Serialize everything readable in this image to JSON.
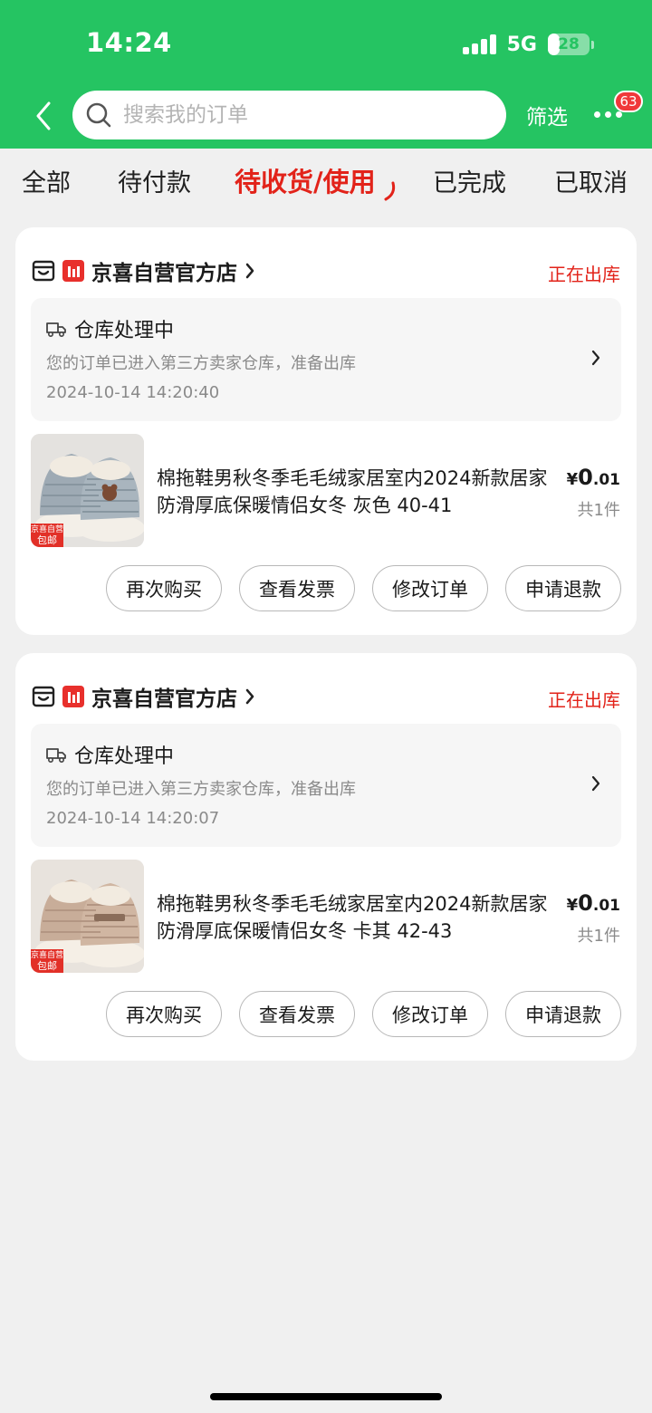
{
  "status_bar": {
    "time": "14:24",
    "network": "5G",
    "battery": "28",
    "battery_level": 0.28
  },
  "header": {
    "search_placeholder": "搜索我的订单",
    "filter_label": "筛选",
    "message_badge": "63"
  },
  "tabs": [
    {
      "label": "全部",
      "active": false
    },
    {
      "label": "待付款",
      "active": false
    },
    {
      "label": "待收货/使用",
      "active": true
    },
    {
      "label": "已完成",
      "active": false
    },
    {
      "label": "已取消",
      "active": false
    }
  ],
  "orders": [
    {
      "store_name": "京喜自营官方店",
      "status": "正在出库",
      "progress_title": "仓库处理中",
      "progress_desc": "您的订单已进入第三方卖家仓库，准备出库",
      "progress_time": "2024-10-14 14:20:40",
      "product_title": "棉拖鞋男秋冬季毛毛绒家居室内2024新款居家防滑厚底保暖情侣女冬 灰色 40-41",
      "image_tag_line1": "京喜自营",
      "image_tag_line2": "包邮",
      "price_currency": "¥",
      "price_int": "0",
      "price_dec": ".01",
      "quantity": "共1件",
      "buttons": [
        "再次购买",
        "查看发票",
        "修改订单",
        "申请退款"
      ]
    },
    {
      "store_name": "京喜自营官方店",
      "status": "正在出库",
      "progress_title": "仓库处理中",
      "progress_desc": "您的订单已进入第三方卖家仓库，准备出库",
      "progress_time": "2024-10-14 14:20:07",
      "product_title": "棉拖鞋男秋冬季毛毛绒家居室内2024新款居家防滑厚底保暖情侣女冬 卡其 42-43",
      "image_tag_line1": "京喜自营",
      "image_tag_line2": "包邮",
      "price_currency": "¥",
      "price_int": "0",
      "price_dec": ".01",
      "quantity": "共1件",
      "buttons": [
        "再次购买",
        "查看发票",
        "修改订单",
        "申请退款"
      ]
    }
  ],
  "colors": {
    "brand_green": "#25c462",
    "accent_red": "#e2231a",
    "slipper_gray": "#9eaab4",
    "slipper_khaki": "#c8ad99"
  },
  "icons": [
    "chevron-left-icon",
    "search-icon",
    "more-icon",
    "store-icon",
    "store-brand-icon",
    "chevron-right-icon",
    "truck-icon"
  ]
}
